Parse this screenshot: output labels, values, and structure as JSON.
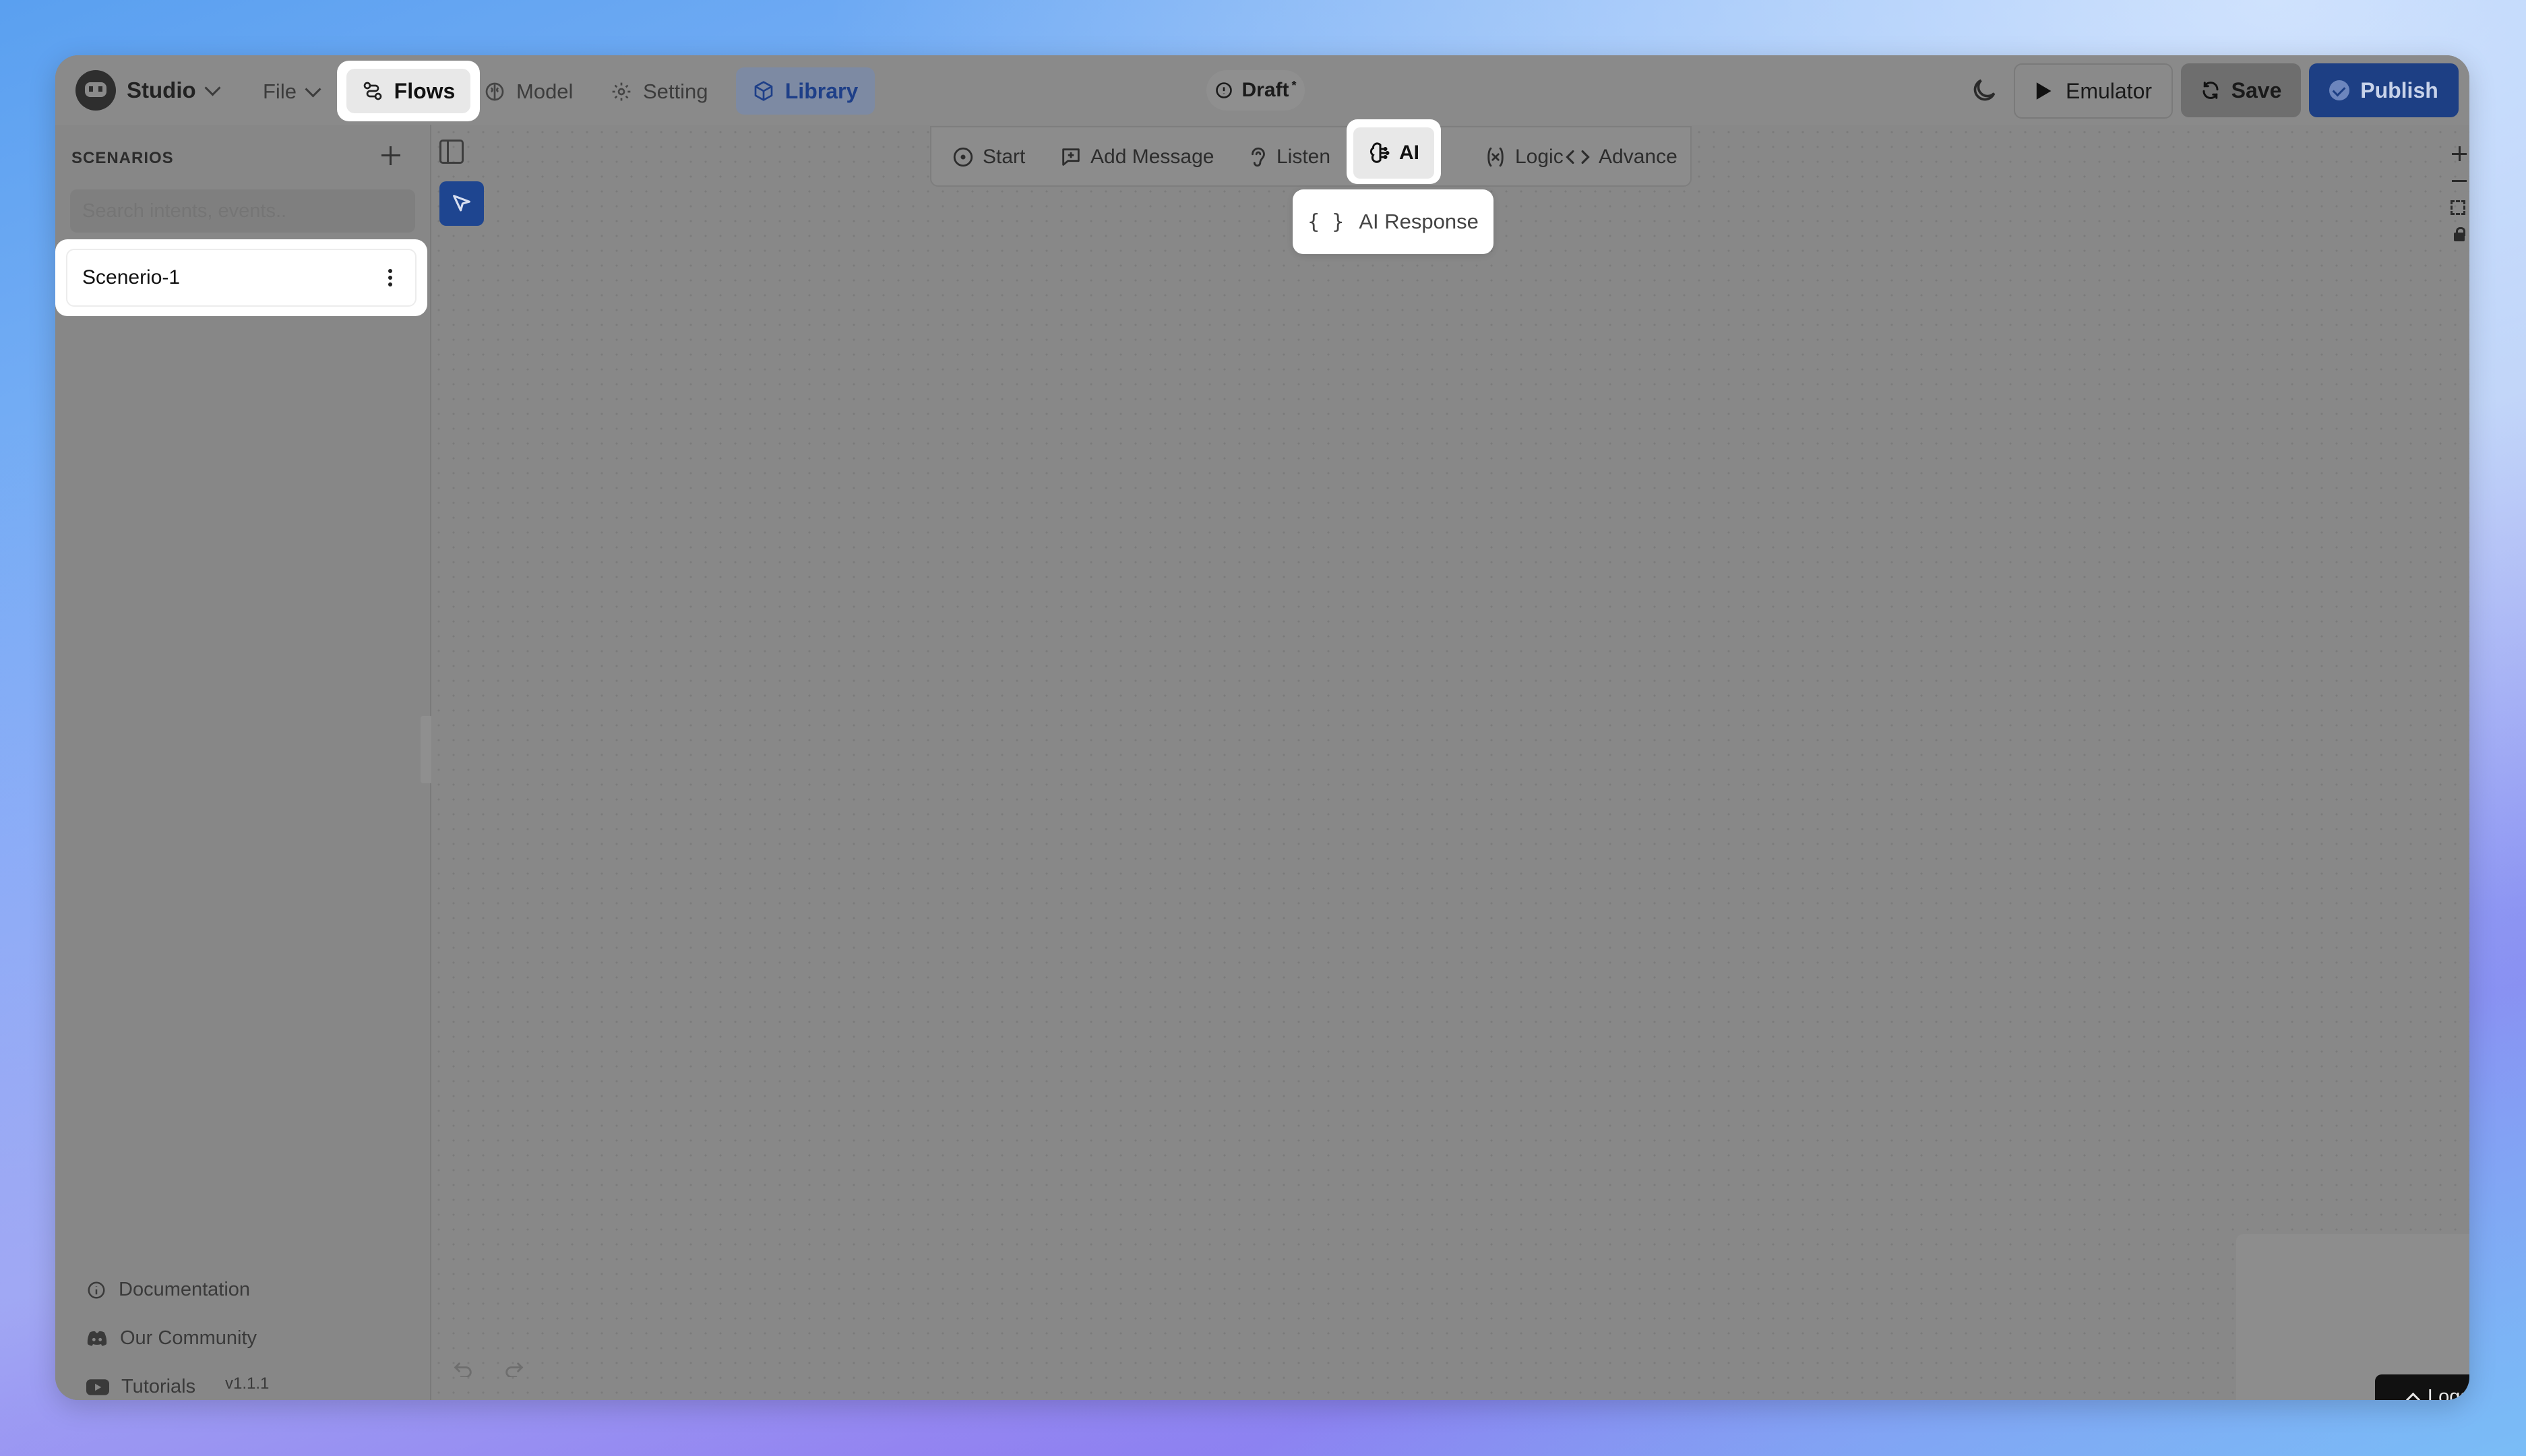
{
  "app": {
    "name": "Studio",
    "menu": {
      "file": "File"
    },
    "nav": {
      "flows": "Flows",
      "model": "Model",
      "setting": "Setting",
      "library": "Library"
    },
    "status": {
      "label": "Draft",
      "marker": "*"
    },
    "actions": {
      "emulator": "Emulator",
      "save": "Save",
      "publish": "Publish"
    }
  },
  "sidebar": {
    "title": "SCENARIOS",
    "search_placeholder": "Search intents, events..",
    "scenarios": [
      {
        "label": "Scenerio-1"
      }
    ],
    "footer_links": [
      {
        "label": "Documentation",
        "icon": "info-icon"
      },
      {
        "label": "Our Community",
        "icon": "discord-icon"
      },
      {
        "label": "Tutorials",
        "icon": "youtube-icon"
      }
    ],
    "version": "v1.1.1"
  },
  "canvas_toolbar": {
    "items": [
      {
        "label": "Start",
        "icon": "circle-dot-icon"
      },
      {
        "label": "Add Message",
        "icon": "message-plus-icon"
      },
      {
        "label": "Listen",
        "icon": "ear-icon"
      },
      {
        "label": "AI",
        "icon": "brain-icon"
      },
      {
        "label": "Logic",
        "icon": "variable-icon"
      },
      {
        "label": "Advance",
        "icon": "code-icon"
      }
    ],
    "ai_dropdown": {
      "label": "AI Response",
      "icon": "braces-icon"
    }
  },
  "bottom": {
    "logs": "Logs"
  },
  "colors": {
    "accent": "#1d3f84",
    "library_text": "#1e3f88",
    "overlay": "#878787"
  }
}
